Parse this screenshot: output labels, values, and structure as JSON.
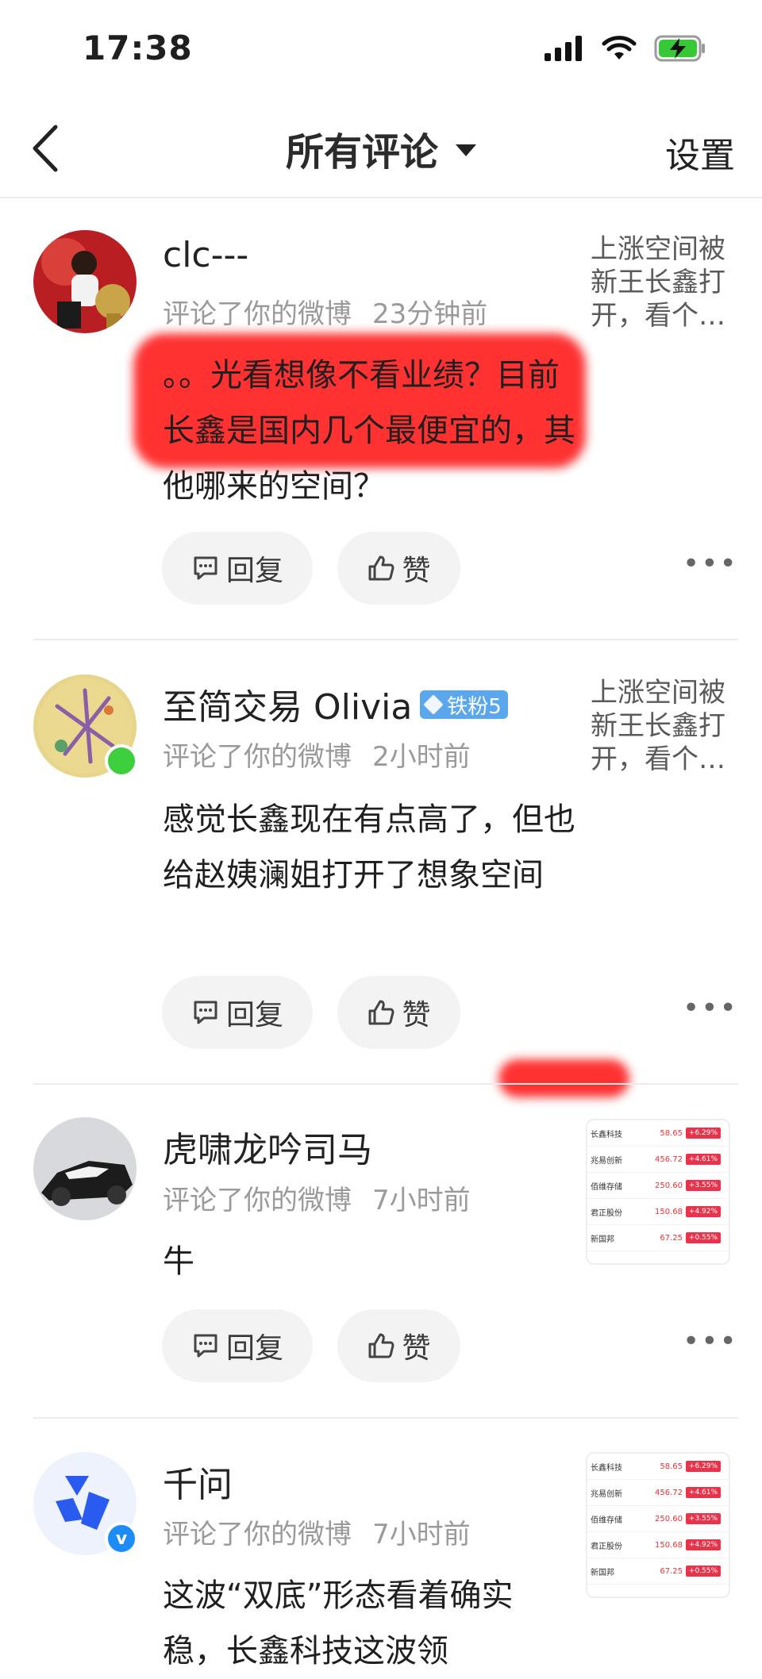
{
  "status_bar": {
    "time": "17:38"
  },
  "nav": {
    "title": "所有评论",
    "right": "设置"
  },
  "actions": {
    "reply": "回复",
    "like": "赞"
  },
  "comments": [
    {
      "username": "clc---",
      "action": "评论了你的微博",
      "time": "23分钟前",
      "content": "。。光看想像不看业绩？目前长鑫是国内几个最便宜的，其他哪来的空间？",
      "quote": "上涨空间被新王长鑫打开，看个…"
    },
    {
      "username": "至简交易 Olivia",
      "badge": "铁粉5",
      "action": "评论了你的微博",
      "time": "2小时前",
      "content": "感觉长鑫现在有点高了，但也给赵姨澜姐打开了想象空间",
      "quote": "上涨空间被新王长鑫打开，看个…"
    },
    {
      "username": "虎啸龙吟司马",
      "action": "评论了你的微博",
      "time": "7小时前",
      "content": "牛"
    },
    {
      "username": "千问",
      "action": "评论了你的微博",
      "time": "7小时前",
      "content": "这波“双底”形态看着确实稳，长鑫科技这波领"
    }
  ],
  "stock_thumb": {
    "rows": [
      {
        "name": "长鑫科技",
        "price": "58.65",
        "change": "+6.29%"
      },
      {
        "name": "兆易创新",
        "price": "456.72",
        "change": "+4.61%"
      },
      {
        "name": "佰维存储",
        "price": "250.60",
        "change": "+3.55%"
      },
      {
        "name": "君正股份",
        "price": "150.68",
        "change": "+4.92%"
      },
      {
        "name": "新国邦",
        "price": "67.25",
        "change": "+0.55%"
      }
    ]
  },
  "colors": {
    "accent_blue": "#1d8cf8",
    "online_green": "#3ecf3e",
    "redact": "#ff2020"
  }
}
